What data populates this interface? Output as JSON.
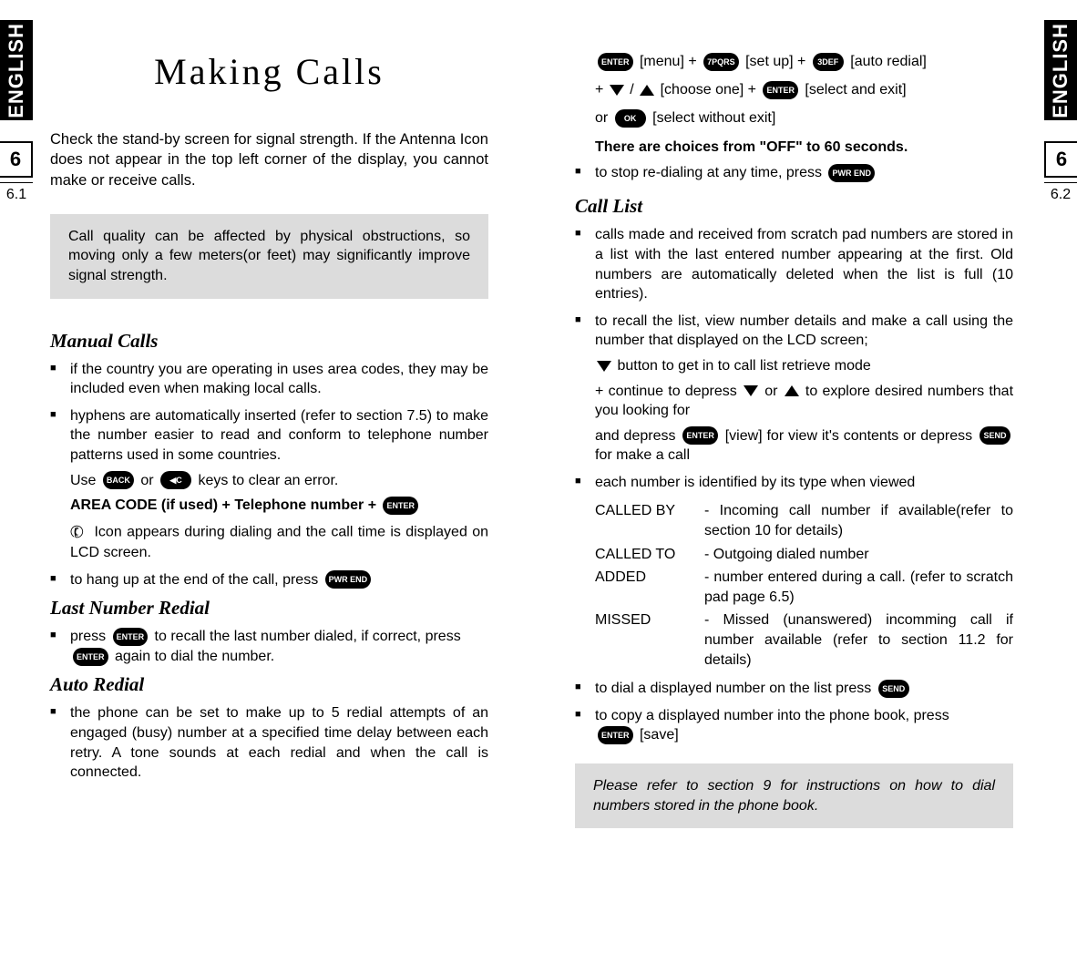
{
  "sideTabs": {
    "lang": "ENGLISH",
    "chapter": "6",
    "leftSub": "6.1",
    "rightSub": "6.2"
  },
  "left": {
    "title": "Making Calls",
    "intro": "Check the stand-by screen for signal strength. If the Antenna Icon does not appear in the top left corner of the display, you cannot make or receive calls.",
    "callout1": "Call quality can be affected by physical obstructions, so moving only a few meters(or feet) may significantly improve signal strength.",
    "manual": {
      "heading": "Manual Calls",
      "b1": "if the country you are operating in uses area codes, they may be included even when making local calls.",
      "b2": "hyphens are automatically inserted (refer to section 7.5) to make the number easier to read and conform to telephone number patterns used in some countries.",
      "useLine_a": "Use ",
      "useLine_b": " or ",
      "useLine_c": " keys to clear an error.",
      "areaLine": "AREA CODE (if used) + Telephone number + ",
      "iconLine": "Icon appears during dialing and the call time is displayed on LCD screen.",
      "hangup_a": "to hang up at the end of the call, press "
    },
    "lastRedial": {
      "heading": "Last Number Redial",
      "b1_a": "press ",
      "b1_b": " to recall the last number dialed, if correct, press ",
      "b1_c": " again to dial the number."
    },
    "autoRedial": {
      "heading": "Auto Redial",
      "b1": "the phone can be set to make up to 5 redial attempts of an engaged (busy) number at a specified time delay between each retry. A tone sounds at each redial and when the call is connected."
    }
  },
  "right": {
    "seq": {
      "l1_a": "[menu] + ",
      "l1_b": " [set up] + ",
      "l1_c": " [auto redial]",
      "l2_a": "+ ",
      "l2_b": " / ",
      "l2_c": " [choose one] + ",
      "l2_d": " [select and exit]",
      "l3_a": "or ",
      "l3_b": " [select without exit]",
      "l4": "There are choices from \"OFF\" to 60 seconds."
    },
    "stop_a": "to stop re-dialing at any time, press ",
    "callList": {
      "heading": "Call List",
      "b1": "calls made and received from scratch pad numbers are stored in a list with the last entered number appearing at the first. Old numbers are automatically deleted when the list is full (10 entries).",
      "b2": "to recall the list, view number details and make a call using the number that displayed on the LCD screen;",
      "s1_b": " button to get in to call list retrieve mode",
      "s2_a": "+ continue to depress ",
      "s2_b": " or ",
      "s2_c": " to explore desired numbers that you looking for",
      "s3_a": "and depress ",
      "s3_b": " [view] for view it's contents or depress ",
      "s3_c": " for make a call",
      "b3": "each number is identified by its type when viewed",
      "defs": [
        {
          "t": "CALLED BY",
          "d": "- Incoming call number if available(refer to section 10 for details)"
        },
        {
          "t": "CALLED TO",
          "d": "- Outgoing dialed number"
        },
        {
          "t": "ADDED",
          "d": "- number entered during a call. (refer to scratch pad page 6.5)"
        },
        {
          "t": "MISSED",
          "d": "- Missed (unanswered) incomming call if number available (refer to section 11.2 for details)"
        }
      ],
      "b4_a": "to dial a displayed number on the list press ",
      "b5_a": "to copy a displayed number into the phone book, press ",
      "b5_b": " [save]"
    },
    "callout2": "Please refer to section 9 for instructions on how to dial numbers stored in the phone book."
  },
  "pills": {
    "enter": "ENTER",
    "back": "BACK",
    "clear": "◀C",
    "pwr": "PWR END",
    "menu": "ENTER",
    "seven": "7PQRS",
    "three": "3DEF",
    "send": "SEND",
    "ok": "OK"
  }
}
